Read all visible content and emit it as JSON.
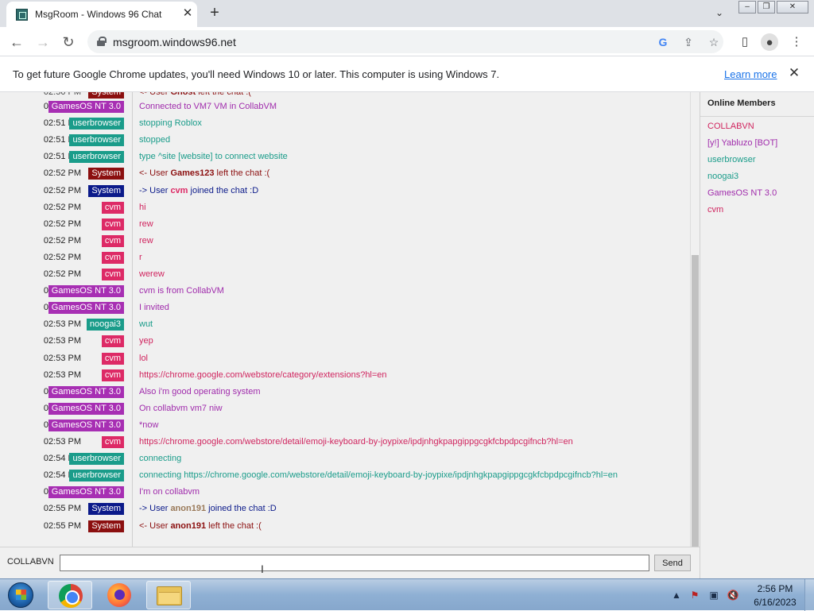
{
  "browser": {
    "tab_title": "MsgRoom - Windows 96 Chat",
    "url": "msgroom.windows96.net",
    "infobar_text": "To get future Google Chrome updates, you'll need Windows 10 or later. This computer is using Windows 7.",
    "learn_more": "Learn more"
  },
  "colors": {
    "GamesOS NT 3.0": "#a72fb3",
    "userbrowser": "#1a9c8a",
    "System_dark": "#8b0f0f",
    "System_blue": "#0b1a8a",
    "cvm": "#dd2a66",
    "noogai3": "#1a9c8a"
  },
  "chat": {
    "messages": [
      {
        "time": "02:51 PM",
        "user": "GamesOS NT 3.0",
        "badge": "#a72fb3",
        "color": "#a02cac",
        "text": "Connected to VM7 VM in CollabVM"
      },
      {
        "time": "02:51 PM",
        "user": "userbrowser",
        "badge": "#1a9c8a",
        "color": "#1a9c8a",
        "text": "stopping Roblox"
      },
      {
        "time": "02:51 PM",
        "user": "userbrowser",
        "badge": "#1a9c8a",
        "color": "#1a9c8a",
        "text": "stopped"
      },
      {
        "time": "02:51 PM",
        "user": "userbrowser",
        "badge": "#1a9c8a",
        "color": "#1a9c8a",
        "text": "type ^site [website] to connect website"
      },
      {
        "time": "02:52 PM",
        "user": "System",
        "badge": "#8b0f0f",
        "color": "#8b0f0f",
        "pre": "<- User ",
        "nick": "Games123",
        "post": " left the chat :("
      },
      {
        "time": "02:52 PM",
        "user": "System",
        "badge": "#0b1a8a",
        "color": "#0b1a8a",
        "pre": "-> User ",
        "nick": "cvm",
        "nick_color": "#dd2a66",
        "post": " joined the chat :D"
      },
      {
        "time": "02:52 PM",
        "user": "cvm",
        "badge": "#dd2a66",
        "color": "#d0255f",
        "text": "hi"
      },
      {
        "time": "02:52 PM",
        "user": "cvm",
        "badge": "#dd2a66",
        "color": "#d0255f",
        "text": "rew"
      },
      {
        "time": "02:52 PM",
        "user": "cvm",
        "badge": "#dd2a66",
        "color": "#d0255f",
        "text": "rew"
      },
      {
        "time": "02:52 PM",
        "user": "cvm",
        "badge": "#dd2a66",
        "color": "#d0255f",
        "text": "r"
      },
      {
        "time": "02:52 PM",
        "user": "cvm",
        "badge": "#dd2a66",
        "color": "#d0255f",
        "text": "werew"
      },
      {
        "time": "02:52 PM",
        "user": "GamesOS NT 3.0",
        "badge": "#a72fb3",
        "color": "#a02cac",
        "text": "cvm is from CollabVM"
      },
      {
        "time": "02:52 PM",
        "user": "GamesOS NT 3.0",
        "badge": "#a72fb3",
        "color": "#a02cac",
        "text": "I invited"
      },
      {
        "time": "02:53 PM",
        "user": "noogai3",
        "badge": "#1a9c8a",
        "color": "#1a9c8a",
        "text": "wut"
      },
      {
        "time": "02:53 PM",
        "user": "cvm",
        "badge": "#dd2a66",
        "color": "#d0255f",
        "text": "yep"
      },
      {
        "time": "02:53 PM",
        "user": "cvm",
        "badge": "#dd2a66",
        "color": "#d0255f",
        "text": "lol"
      },
      {
        "time": "02:53 PM",
        "user": "cvm",
        "badge": "#dd2a66",
        "color": "#d0255f",
        "text": "https://chrome.google.com/webstore/category/extensions?hl=en"
      },
      {
        "time": "02:53 PM",
        "user": "GamesOS NT 3.0",
        "badge": "#a72fb3",
        "color": "#a02cac",
        "text": "Also i'm good operating system"
      },
      {
        "time": "02:53 PM",
        "user": "GamesOS NT 3.0",
        "badge": "#a72fb3",
        "color": "#a02cac",
        "text": "On collabvm vm7 niw"
      },
      {
        "time": "02:53 PM",
        "user": "GamesOS NT 3.0",
        "badge": "#a72fb3",
        "color": "#a02cac",
        "text": "*now"
      },
      {
        "time": "02:53 PM",
        "user": "cvm",
        "badge": "#dd2a66",
        "color": "#d0255f",
        "text": "https://chrome.google.com/webstore/detail/emoji-keyboard-by-joypixe/ipdjnhgkpapgippgcgkfcbpdpcgifncb?hl=en"
      },
      {
        "time": "02:54 PM",
        "user": "userbrowser",
        "badge": "#1a9c8a",
        "color": "#1a9c8a",
        "text": "connecting"
      },
      {
        "time": "02:54 PM",
        "user": "userbrowser",
        "badge": "#1a9c8a",
        "color": "#1a9c8a",
        "text": "connecting https://chrome.google.com/webstore/detail/emoji-keyboard-by-joypixe/ipdjnhgkpapgippgcgkfcbpdpcgifncb?hl=en"
      },
      {
        "time": "02:55 PM",
        "user": "GamesOS NT 3.0",
        "badge": "#a72fb3",
        "color": "#a02cac",
        "text": "I'm on collabvm"
      },
      {
        "time": "02:55 PM",
        "user": "System",
        "badge": "#0b1a8a",
        "color": "#0b1a8a",
        "pre": "-> User ",
        "nick": "anon191",
        "nick_color": "#9a7a5a",
        "post": " joined the chat :D"
      },
      {
        "time": "02:55 PM",
        "user": "System",
        "badge": "#8b0f0f",
        "color": "#8b0f0f",
        "pre": "<- User ",
        "nick": "anon191",
        "post": " left the chat :("
      }
    ]
  },
  "members": {
    "title": "Online Members",
    "list": [
      {
        "name": "COLLABVN",
        "color": "#d0255f"
      },
      {
        "name": "[y!] Yabluzo [BOT]",
        "color": "#a02cac"
      },
      {
        "name": "userbrowser",
        "color": "#1a9c8a"
      },
      {
        "name": "noogai3",
        "color": "#1a9c8a"
      },
      {
        "name": "GamesOS NT 3.0",
        "color": "#a02cac"
      },
      {
        "name": "cvm",
        "color": "#d0255f"
      }
    ]
  },
  "input": {
    "nickname": "COLLABVN",
    "value": "",
    "send_label": "Send"
  },
  "taskbar": {
    "time": "2:56 PM",
    "date": "6/16/2023"
  }
}
